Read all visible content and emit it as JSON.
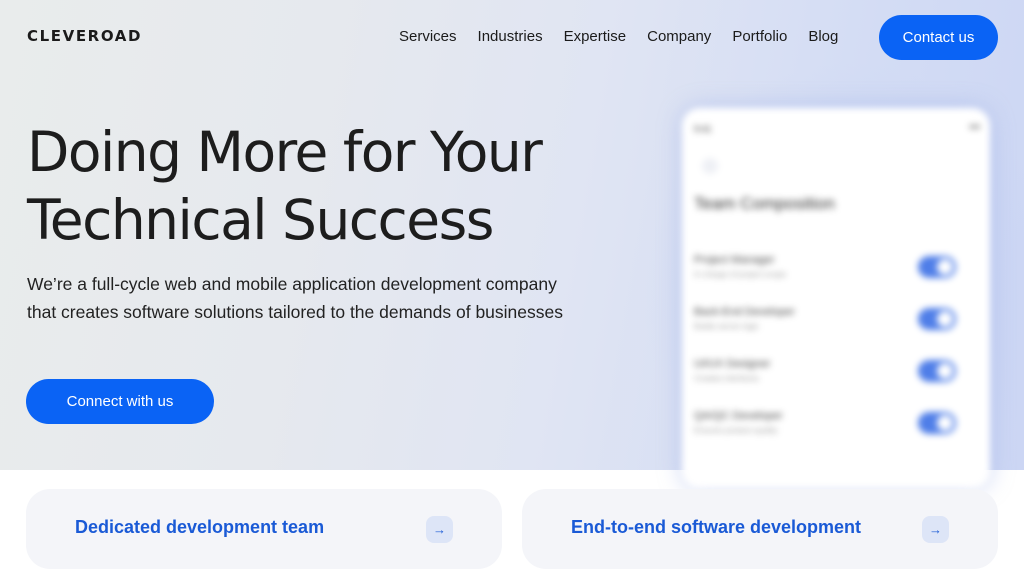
{
  "header": {
    "logo": "CLEVEROAD",
    "nav": [
      "Services",
      "Industries",
      "Expertise",
      "Company",
      "Portfolio",
      "Blog"
    ],
    "contact_label": "Contact us"
  },
  "hero": {
    "headline_line1": "Doing More for Your",
    "headline_line2": "Technical Success",
    "subtext_line1": "We’re a full-cycle web and mobile application development company",
    "subtext_line2": "that creates software solutions tailored to the demands of businesses",
    "cta_label": "Connect with us"
  },
  "phone": {
    "status_time": "9:41",
    "status_icons": "▪▪▪",
    "title": "Team Composition",
    "rows": [
      {
        "title": "Project Manager",
        "sub": "In charge of project scope"
      },
      {
        "title": "Back-End Developer",
        "sub": "Builds server logic"
      },
      {
        "title": "UI/UX Designer",
        "sub": "Creates interfaces"
      },
      {
        "title": "QA/QC Developer",
        "sub": "Ensures product quality"
      }
    ]
  },
  "cards": [
    {
      "title": "Dedicated development team",
      "arrow": "→"
    },
    {
      "title": "End-to-end software development",
      "arrow": "→"
    }
  ],
  "colors": {
    "accent": "#0a63f5",
    "card_title": "#1a5ad6",
    "text": "#1d1d1d"
  }
}
